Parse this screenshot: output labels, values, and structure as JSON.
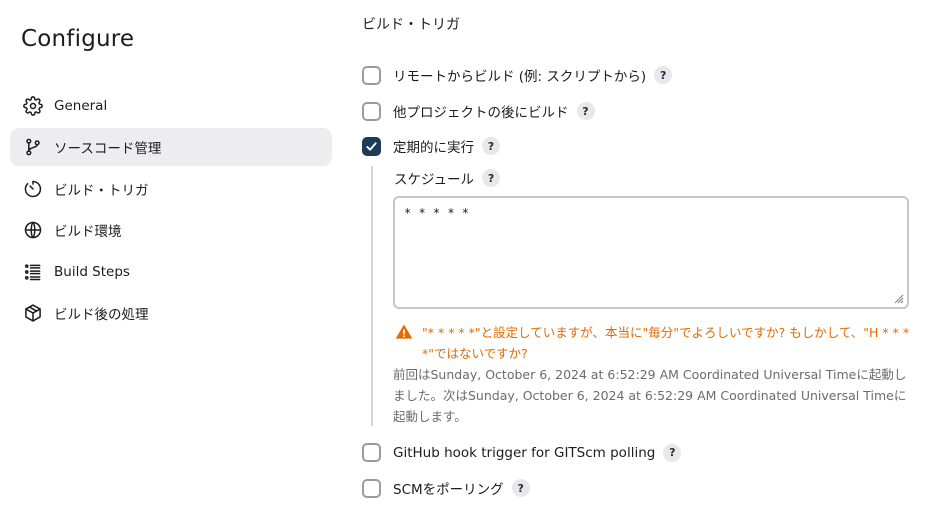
{
  "sidebar": {
    "title": "Configure",
    "items": [
      {
        "label": "General",
        "icon": "gear-icon",
        "active": false
      },
      {
        "label": "ソースコード管理",
        "icon": "source-branch-icon",
        "active": true
      },
      {
        "label": "ビルド・トリガ",
        "icon": "timer-icon",
        "active": false
      },
      {
        "label": "ビルド環境",
        "icon": "globe-icon",
        "active": false
      },
      {
        "label": "Build Steps",
        "icon": "list-icon",
        "active": false
      },
      {
        "label": "ビルド後の処理",
        "icon": "package-icon",
        "active": false
      }
    ]
  },
  "main": {
    "section_title": "ビルド・トリガ",
    "options": [
      {
        "label": "リモートからビルド (例: スクリプトから)",
        "checked": false
      },
      {
        "label": "他プロジェクトの後にビルド",
        "checked": false
      },
      {
        "label": "定期的に実行",
        "checked": true
      },
      {
        "label": "GitHub hook trigger for GITScm polling",
        "checked": false
      },
      {
        "label": "SCMをポーリング",
        "checked": false
      }
    ],
    "help_glyph": "?",
    "schedule": {
      "label": "スケジュール",
      "value": "* * * * *"
    },
    "warning": "\"* * * * *\"と設定していますが、本当に\"毎分\"でよろしいですか? もしかして、\"H * * * *\"ではないですか?",
    "info": "前回はSunday, October 6, 2024 at 6:52:29 AM Coordinated Universal Timeに起動しました。次はSunday, October 6, 2024 at 6:52:29 AM Coordinated Universal Timeに起動します。"
  },
  "colors": {
    "checkbox_checked": "#1d3b58",
    "warning": "#e56a00",
    "active_nav_bg": "#ededf0"
  }
}
